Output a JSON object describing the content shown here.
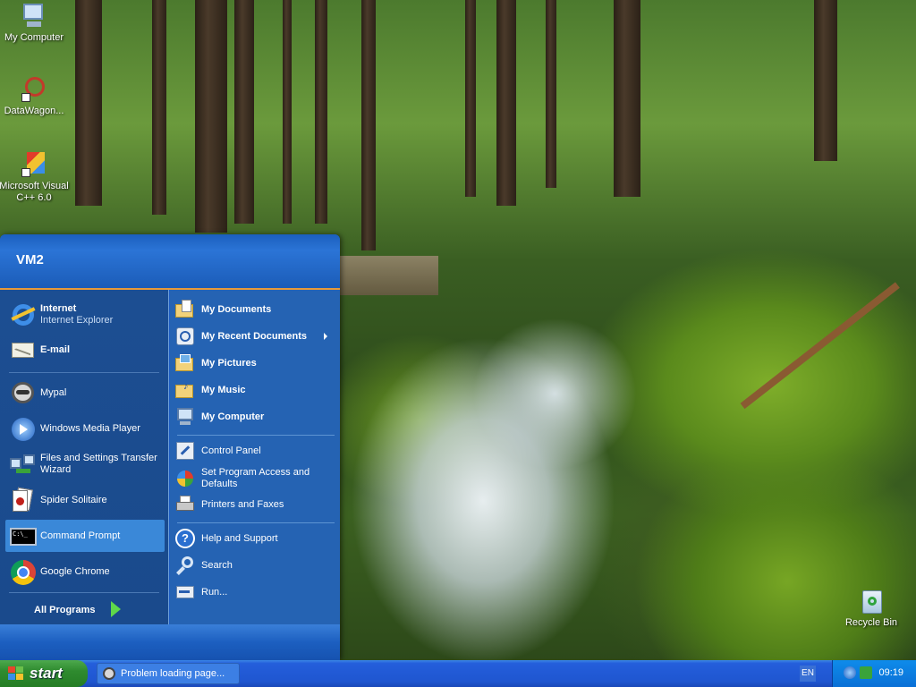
{
  "desktop": {
    "icons": [
      {
        "label": "My Computer"
      },
      {
        "label": "DataWagon..."
      },
      {
        "label": "Microsoft Visual C++ 6.0"
      },
      {
        "label": "Recycle Bin"
      }
    ]
  },
  "start_menu": {
    "user_name": "VM2",
    "pinned": [
      {
        "title": "Internet",
        "subtitle": "Internet Explorer",
        "icon": "internet-explorer-icon"
      },
      {
        "title": "E-mail",
        "icon": "email-icon"
      }
    ],
    "recent": [
      {
        "label": "Mypal",
        "icon": "mypal-icon"
      },
      {
        "label": "Windows Media Player",
        "icon": "media-player-icon"
      },
      {
        "label": "Files and Settings Transfer Wizard",
        "icon": "transfer-wizard-icon"
      },
      {
        "label": "Spider Solitaire",
        "icon": "spider-solitaire-icon"
      },
      {
        "label": "Command Prompt",
        "icon": "command-prompt-icon",
        "selected": true
      },
      {
        "label": "Google Chrome",
        "icon": "chrome-icon"
      }
    ],
    "all_programs": "All Programs",
    "places": [
      {
        "label": "My Documents",
        "icon": "folder-documents-icon"
      },
      {
        "label": "My Recent Documents",
        "icon": "recent-documents-icon",
        "submenu": true
      },
      {
        "label": "My Pictures",
        "icon": "folder-pictures-icon"
      },
      {
        "label": "My Music",
        "icon": "folder-music-icon"
      },
      {
        "label": "My Computer",
        "icon": "computer-icon"
      }
    ],
    "system": [
      {
        "label": "Control Panel",
        "icon": "control-panel-icon"
      },
      {
        "label": "Set Program Access and Defaults",
        "icon": "program-defaults-icon"
      },
      {
        "label": "Printers and Faxes",
        "icon": "printer-icon"
      }
    ],
    "help": [
      {
        "label": "Help and Support",
        "icon": "help-icon"
      },
      {
        "label": "Search",
        "icon": "search-icon"
      },
      {
        "label": "Run...",
        "icon": "run-icon"
      }
    ]
  },
  "taskbar": {
    "start_label": "start",
    "task_label": "Problem loading page...",
    "language": "EN",
    "clock": "09:19"
  }
}
